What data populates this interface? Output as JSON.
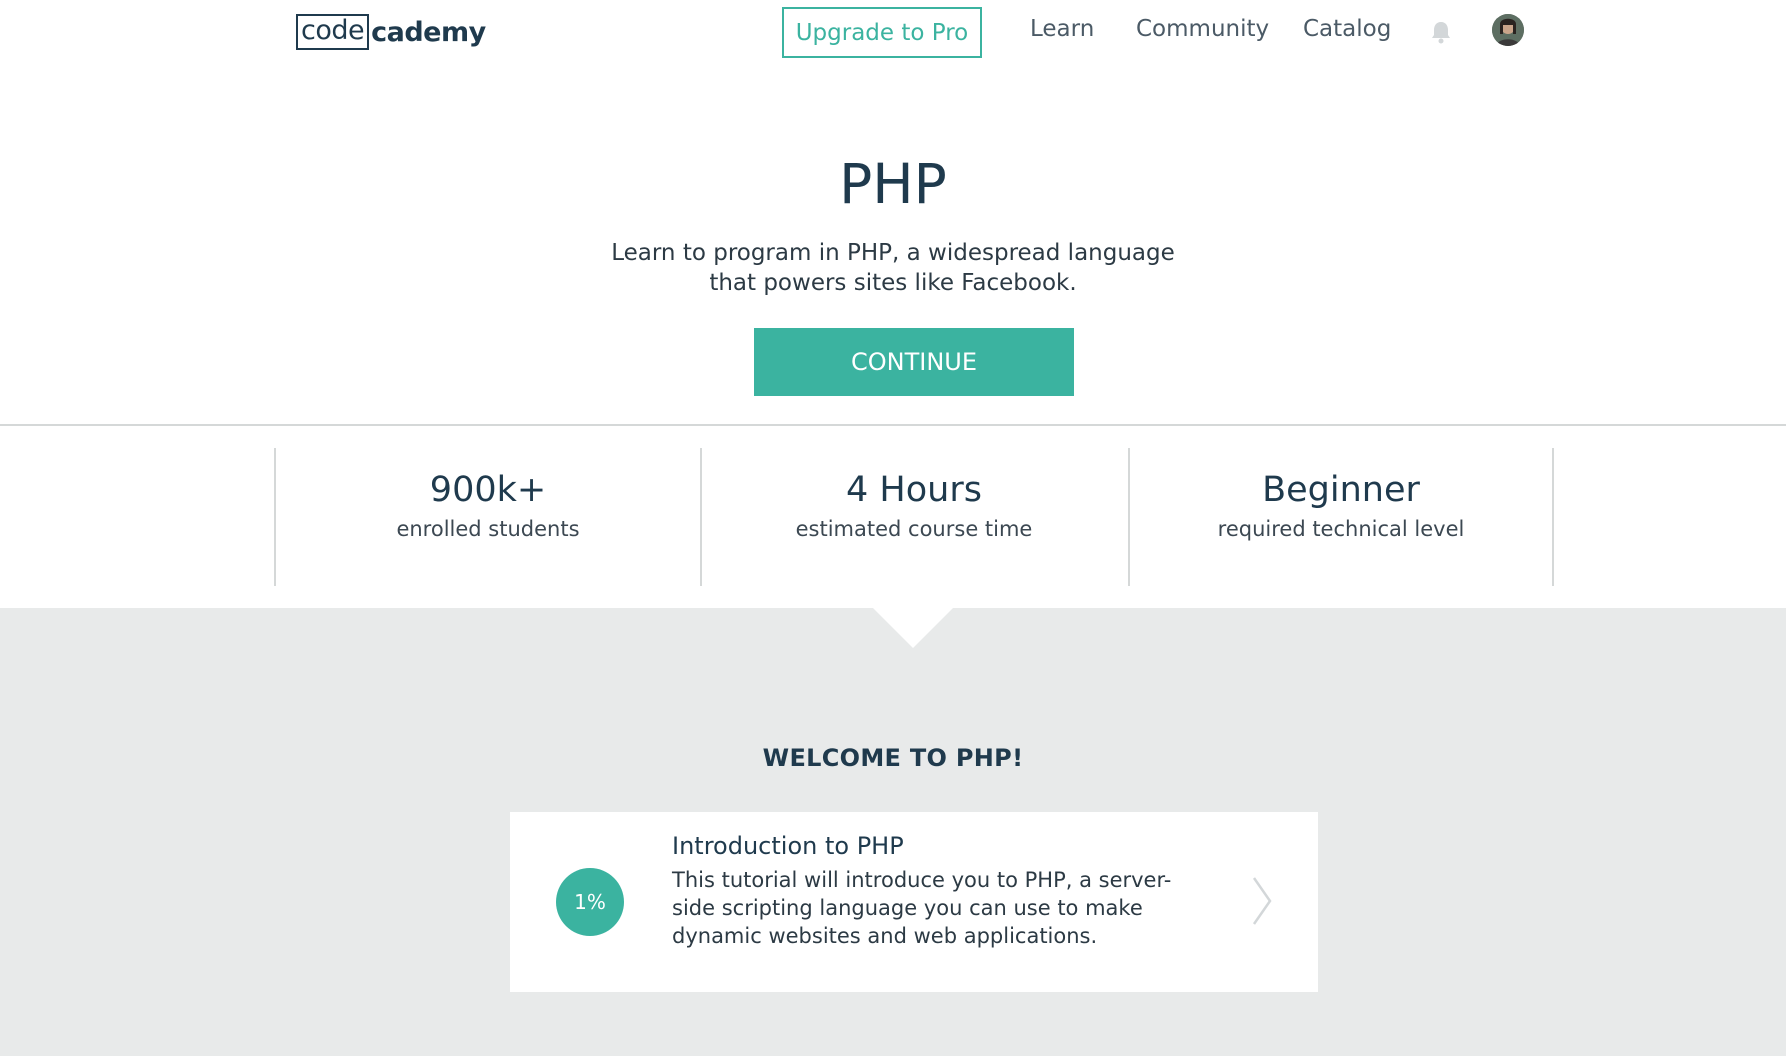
{
  "header": {
    "logo_boxed": "code",
    "logo_rest": "cademy",
    "upgrade_label": "Upgrade to Pro",
    "nav": [
      "Learn",
      "Community",
      "Catalog"
    ],
    "icons": {
      "notifications": "bell-icon",
      "avatar": "user-avatar"
    }
  },
  "hero": {
    "title": "PHP",
    "description": "Learn to program in PHP, a widespread language that powers sites like Facebook.",
    "continue_label": "CONTINUE"
  },
  "stats": [
    {
      "value": "900k+",
      "label": "enrolled students"
    },
    {
      "value": "4 Hours",
      "label": "estimated course time"
    },
    {
      "value": "Beginner",
      "label": "required technical level"
    }
  ],
  "welcome": "WELCOME TO PHP!",
  "course_card": {
    "progress": "1%",
    "title": "Introduction to PHP",
    "description": "This tutorial will introduce you to PHP, a server-side scripting language you can use to make dynamic websites and web applications.",
    "chevron_icon": "chevron-right-icon"
  },
  "colors": {
    "accent": "#3bb3a0",
    "navy": "#1f3a4d",
    "grey_bg": "#e8eaea"
  }
}
